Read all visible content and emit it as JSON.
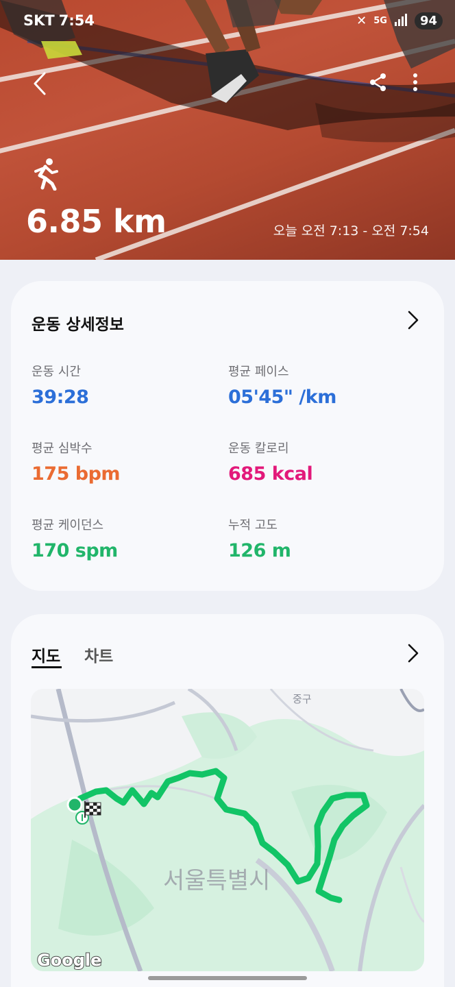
{
  "status_bar": {
    "carrier": "SKT",
    "time": "7:54",
    "network": "5G",
    "battery": "94"
  },
  "hero": {
    "activity_icon": "running-icon",
    "distance": "6.85 km",
    "time_range": "오늘 오전 7:13 - 오전 7:54"
  },
  "details": {
    "title": "운동 상세정보",
    "stats": [
      {
        "label": "운동 시간",
        "value": "39:28",
        "color": "#2c6fd8"
      },
      {
        "label": "평균 페이스",
        "value": "05'45\" /km",
        "color": "#2c6fd8"
      },
      {
        "label": "평균 심박수",
        "value": "175 bpm",
        "color": "#ea6b32"
      },
      {
        "label": "운동 칼로리",
        "value": "685 kcal",
        "color": "#e2197a"
      },
      {
        "label": "평균 케이던스",
        "value": "170 spm",
        "color": "#21b56a"
      },
      {
        "label": "누적 고도",
        "value": "126 m",
        "color": "#21b56a"
      }
    ]
  },
  "map_section": {
    "tabs": [
      {
        "label": "지도",
        "active": true
      },
      {
        "label": "차트",
        "active": false
      }
    ],
    "map": {
      "district_label": "중구",
      "city_label": "서울특별시",
      "attribution": "Google",
      "route_color": "#12c466"
    }
  }
}
